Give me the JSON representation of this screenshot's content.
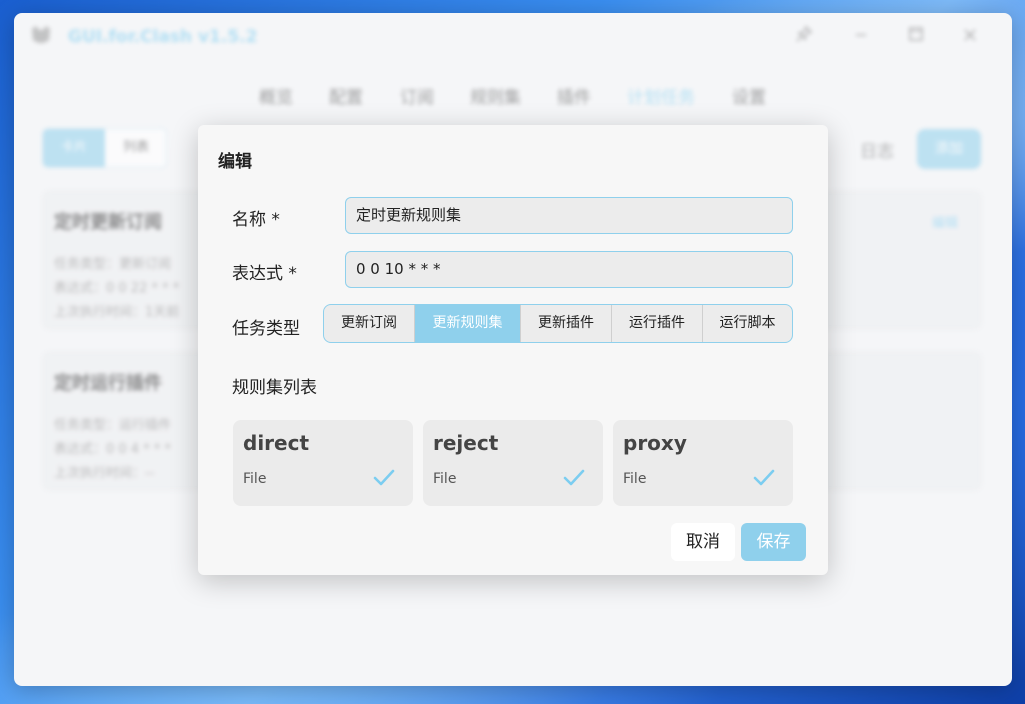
{
  "app": {
    "title": "GUI.for.Clash v1.5.2",
    "accent": "#8fd0ec",
    "window_controls": [
      "pin-icon",
      "minimize-icon",
      "maximize-icon",
      "close-icon"
    ]
  },
  "nav": {
    "items": [
      "概览",
      "配置",
      "订阅",
      "规则集",
      "插件",
      "计划任务",
      "设置"
    ],
    "active_index": 5
  },
  "toolbar": {
    "view_toggle": [
      "卡片",
      "列表"
    ],
    "log_label": "日志",
    "add_label": "添加"
  },
  "background_cards": [
    {
      "title": "定时更新订阅",
      "lines": [
        "任务类型：更新订阅",
        "表达式：0 0 22 * * *",
        "上次执行时间：1天前"
      ],
      "edit_label": "编辑"
    },
    {
      "title": "定时运行插件",
      "lines": [
        "任务类型：运行插件",
        "表达式：0 0 4 * * *",
        "上次执行时间：--"
      ]
    }
  ],
  "dialog": {
    "title": "编辑",
    "name_label": "名称 *",
    "name_value": "定时更新规则集",
    "expr_label": "表达式 *",
    "expr_value": "0 0 10 * * *",
    "type_label": "任务类型",
    "type_options": [
      "更新订阅",
      "更新规则集",
      "更新插件",
      "运行插件",
      "运行脚本"
    ],
    "type_selected_index": 1,
    "ruleset_label": "规则集列表",
    "rulesets": [
      {
        "name": "direct",
        "type": "File",
        "checked": true
      },
      {
        "name": "reject",
        "type": "File",
        "checked": true
      },
      {
        "name": "proxy",
        "type": "File",
        "checked": true
      }
    ],
    "cancel_label": "取消",
    "save_label": "保存"
  }
}
